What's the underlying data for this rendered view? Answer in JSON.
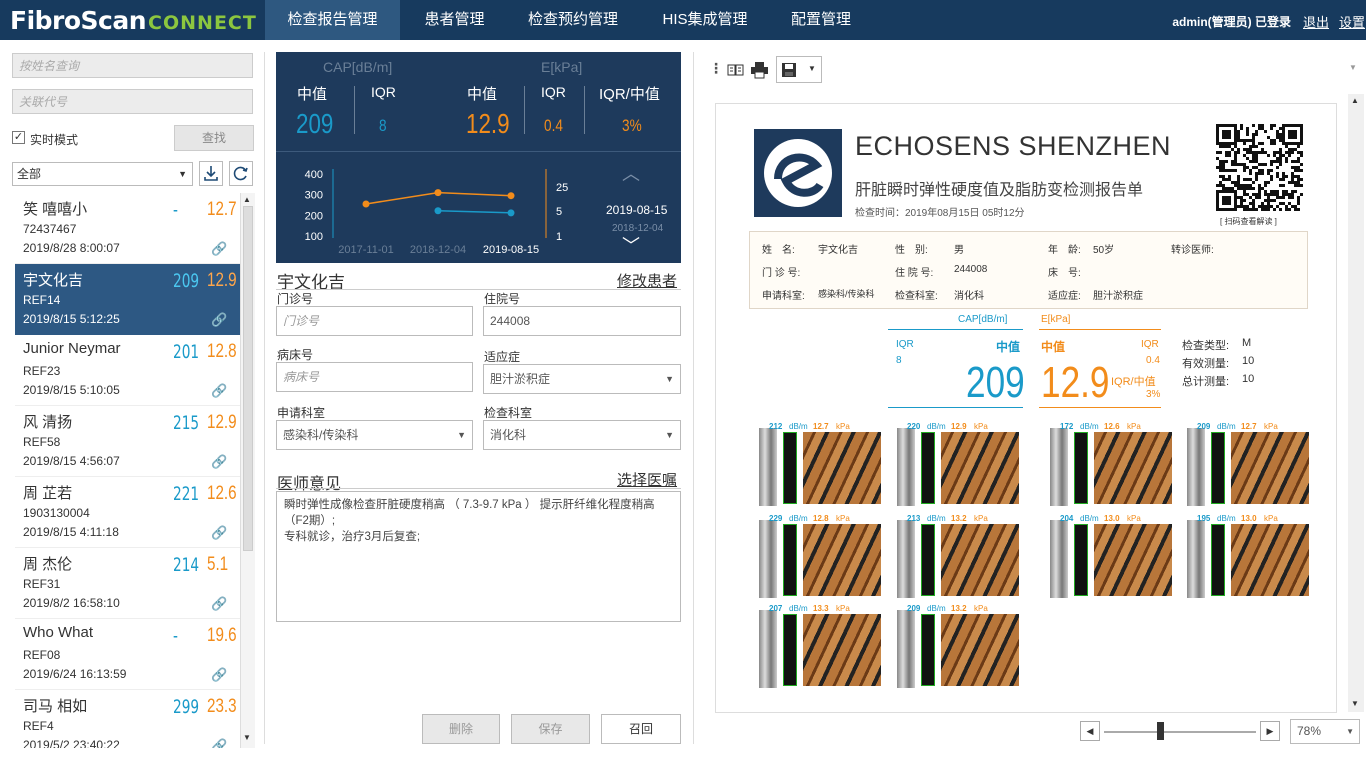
{
  "app": {
    "logo": "FibroScan",
    "logo2": "CONNECT"
  },
  "nav": [
    "检查报告管理",
    "患者管理",
    "检查预约管理",
    "HIS集成管理",
    "配置管理"
  ],
  "user": {
    "name": "admin(管理员) 已登录",
    "logout": "退出",
    "settings": "设置"
  },
  "search": {
    "name_ph": "按姓名查询",
    "code_ph": "关联代号",
    "realtime": "实时模式",
    "find": "查找",
    "filter": "全部"
  },
  "patients": [
    {
      "name": "笑 嘻嘻小",
      "id": "72437467",
      "date": "2019/8/28 8:00:07",
      "cap": "-",
      "e": "12.7"
    },
    {
      "name": "宇文化吉",
      "id": "REF14",
      "date": "2019/8/15 5:12:25",
      "cap": "209",
      "e": "12.9"
    },
    {
      "name": "Junior Neymar",
      "id": "REF23",
      "date": "2019/8/15 5:10:05",
      "cap": "201",
      "e": "12.8"
    },
    {
      "name": "风 清扬",
      "id": "REF58",
      "date": "2019/8/15 4:56:07",
      "cap": "215",
      "e": "12.9"
    },
    {
      "name": "周 芷若",
      "id": "1903130004",
      "date": "2019/8/15 4:11:18",
      "cap": "221",
      "e": "12.6"
    },
    {
      "name": "周 杰伦",
      "id": "REF31",
      "date": "2019/8/2 16:58:10",
      "cap": "214",
      "e": "5.1"
    },
    {
      "name": "Who What",
      "id": "REF08",
      "date": "2019/6/24 16:13:59",
      "cap": "-",
      "e": "19.6"
    },
    {
      "name": "司马 相如",
      "id": "REF4",
      "date": "2019/5/2 23:40:22",
      "cap": "299",
      "e": "23.3"
    }
  ],
  "summary": {
    "cap_title": "CAP[dB/m]",
    "e_title": "E[kPa]",
    "median": "中值",
    "iqr": "IQR",
    "iqr_med": "IQR/中值",
    "cap_median": "209",
    "cap_iqr": "8",
    "e_median": "12.9",
    "e_iqr": "0.4",
    "e_ratio": "3%",
    "current_date": "2019-08-15",
    "prev_date": "2018-12-04"
  },
  "chart_data": {
    "type": "line",
    "x": [
      "2017-11-01",
      "2018-12-04",
      "2019-08-15"
    ],
    "ylim_left": [
      100,
      400
    ],
    "yticks_left": [
      "400",
      "300",
      "200",
      "100"
    ],
    "ylim_right": [
      1,
      25
    ],
    "yticks_right": [
      "25",
      "5",
      "1"
    ],
    "series": [
      {
        "color": "#f28c1b",
        "values": [
          255,
          310,
          295
        ]
      },
      {
        "color": "#1a9ac9",
        "values": [
          null,
          222,
          212
        ]
      }
    ]
  },
  "form": {
    "patient": "宇文化吉",
    "edit": "修改患者",
    "outpatient_lbl": "门诊号",
    "outpatient_ph": "门诊号",
    "inpatient_lbl": "住院号",
    "inpatient": "244008",
    "bed_lbl": "病床号",
    "bed_ph": "病床号",
    "indication_lbl": "适应症",
    "indication": "胆汁淤积症",
    "dept_lbl": "申请科室",
    "dept": "感染科/传染科",
    "exam_dept_lbl": "检查科室",
    "exam_dept": "消化科",
    "opinion_title": "医师意见",
    "choose": "选择医嘱",
    "opinion_l1": "瞬时弹性成像检查肝脏硬度稍高 （ 7.3-9.7 kPa ） 提示肝纤维化程度稍高",
    "opinion_l2": "（F2期）;",
    "opinion_l3": "专科就诊，治疗3月后复查;",
    "delete": "删除",
    "save": "保存",
    "recall": "召回"
  },
  "report": {
    "company": "ECHOSENS SHENZHEN",
    "title": "肝脏瞬时弹性硬度值及脂肪变检测报告单",
    "time": "检查时间：2019年08月15日 05时12分",
    "qr_caption": "[ 扫码查看解读 ]",
    "name_lbl": "姓　名:",
    "name": "宇文化吉",
    "sex_lbl": "性　别:",
    "sex": "男",
    "age_lbl": "年　龄:",
    "age": "50岁",
    "ref_lbl": "转诊医师:",
    "op_lbl": "门 诊 号:",
    "inp_lbl": "住 院 号:",
    "inp": "244008",
    "bed_lbl": "床　号:",
    "dept_lbl": "申请科室:",
    "dept": "感染科/传染科",
    "edept_lbl": "检查科室:",
    "edept": "消化科",
    "ind_lbl": "适应症:",
    "ind": "胆汁淤积症",
    "cap_t": "CAP[dB/m]",
    "e_t": "E[kPa]",
    "iqr": "IQR",
    "iqr_v": "8",
    "med": "中值",
    "cap": "209",
    "e": "12.9",
    "e_med": "中值",
    "e_iqr": "IQR",
    "e_iqr_v": "0.4",
    "e_ratio_l": "IQR/中值",
    "e_ratio": "3%",
    "type_lbl": "检查类型:",
    "type": "M",
    "valid_lbl": "有效测量:",
    "valid": "10",
    "total_lbl": "总计测量:",
    "total": "10",
    "thumbs": [
      {
        "cap": "212",
        "e": "12.7"
      },
      {
        "cap": "220",
        "e": "12.9"
      },
      {
        "cap": "172",
        "e": "12.6"
      },
      {
        "cap": "209",
        "e": "12.7"
      },
      {
        "cap": "229",
        "e": "12.8"
      },
      {
        "cap": "213",
        "e": "13.2"
      },
      {
        "cap": "204",
        "e": "13.0"
      },
      {
        "cap": "195",
        "e": "13.0"
      },
      {
        "cap": "207",
        "e": "13.3"
      },
      {
        "cap": "209",
        "e": "13.2"
      }
    ],
    "thumb_units": {
      "cap": "dB/m",
      "e": "kPa"
    }
  },
  "zoom": "78%"
}
